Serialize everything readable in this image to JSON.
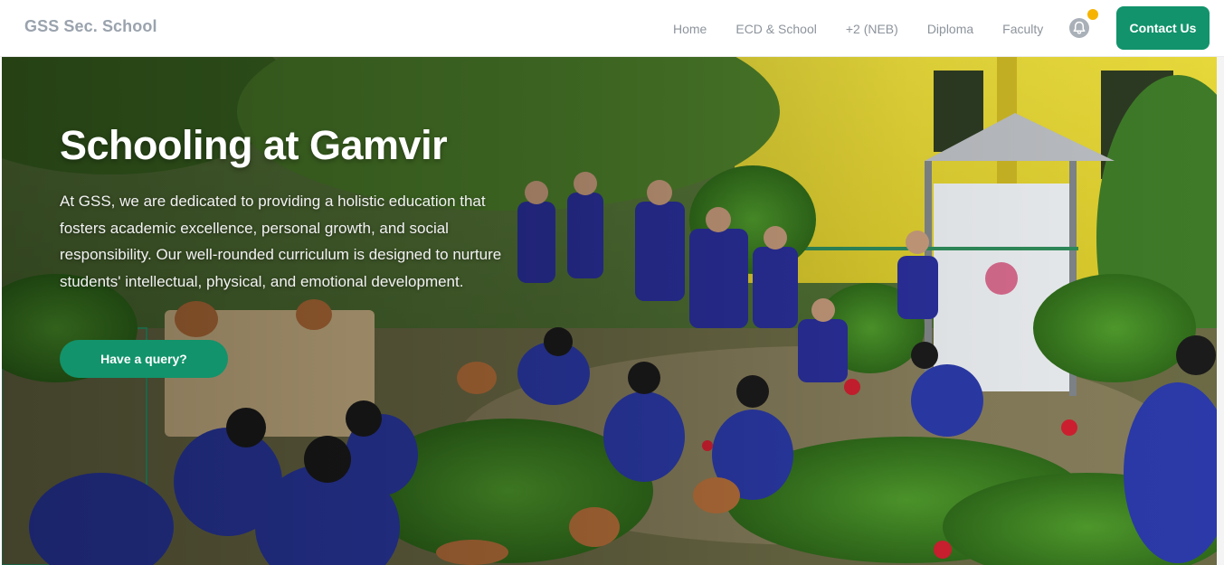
{
  "header": {
    "brand": "GSS Sec. School",
    "nav": [
      {
        "label": "Home"
      },
      {
        "label": "ECD & School"
      },
      {
        "label": "+2 (NEB)"
      },
      {
        "label": "Diploma"
      },
      {
        "label": "Faculty"
      }
    ],
    "notification_icon": "bell-icon",
    "contact_label": "Contact Us"
  },
  "hero": {
    "title": "Schooling at Gamvir",
    "description": "At GSS, we are dedicated to providing a holistic education that fosters academic excellence, personal growth, and social responsibility. Our well-rounded curriculum is designed to nurture students' intellectual, physical, and emotional development.",
    "cta_label": "Have a query?"
  },
  "colors": {
    "primary": "#12936b",
    "notification_dot": "#f6b400",
    "brand_text": "#9aa3ad",
    "nav_text": "#8d949c"
  }
}
